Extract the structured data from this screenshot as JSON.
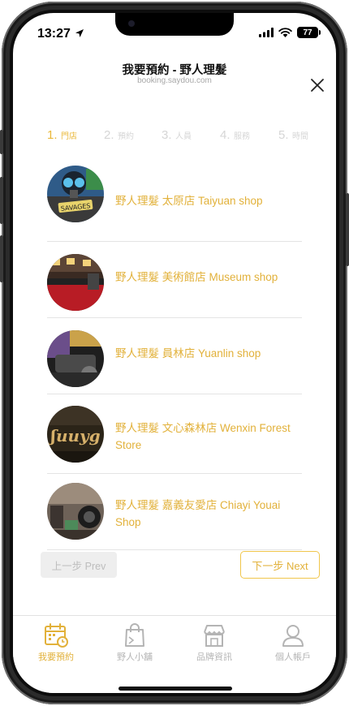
{
  "status_bar": {
    "time": "13:27",
    "battery": "77"
  },
  "header": {
    "title": "我要預約 - 野人理髮",
    "subtitle": "booking.saydou.com"
  },
  "steps": [
    {
      "num": "1.",
      "label": "門店",
      "active": true
    },
    {
      "num": "2.",
      "label": "預約",
      "active": false
    },
    {
      "num": "3.",
      "label": "人員",
      "active": false
    },
    {
      "num": "4.",
      "label": "服務",
      "active": false
    },
    {
      "num": "5.",
      "label": "時間",
      "active": false
    }
  ],
  "stores": [
    {
      "name": "野人理髮 太原店 Taiyuan shop"
    },
    {
      "name": "野人理髮 美術館店 Museum shop"
    },
    {
      "name": "野人理髮 員林店 Yuanlin shop"
    },
    {
      "name": "野人理髮 文心森林店 Wenxin Forest Store"
    },
    {
      "name": "野人理髮 嘉義友愛店 Chiayi Youai Shop"
    }
  ],
  "buttons": {
    "prev": "上一步 Prev",
    "next": "下一步 Next"
  },
  "tabs": [
    {
      "label": "我要預約",
      "icon": "calendar-icon",
      "active": true
    },
    {
      "label": "野人小舖",
      "icon": "shopping-bag-icon",
      "active": false
    },
    {
      "label": "品牌資訊",
      "icon": "storefront-icon",
      "active": false
    },
    {
      "label": "個人帳戶",
      "icon": "user-icon",
      "active": false
    }
  ],
  "colors": {
    "accent": "#e2b13a",
    "inactive": "#b4b4b4",
    "step_inactive": "#d6d6d6"
  }
}
